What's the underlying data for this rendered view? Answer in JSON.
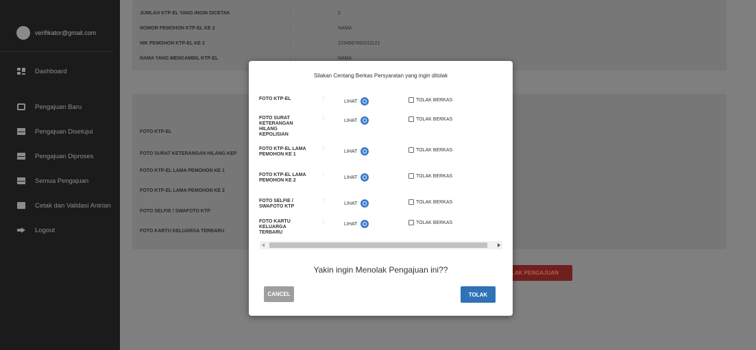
{
  "sidebar": {
    "user_email": "verifikator@gmail.com",
    "items": [
      {
        "label": "Dashboard",
        "icon": "dashboard-icon"
      },
      {
        "label": "Pengajuan Baru",
        "icon": "square-icon"
      },
      {
        "label": "Pengajuan Disetujui",
        "icon": "mail-icon"
      },
      {
        "label": "Pengajuan Diproses",
        "icon": "mail-icon"
      },
      {
        "label": "Semua Pengajuan",
        "icon": "mail-icon"
      },
      {
        "label": "Cetak dan Validasi Antrian",
        "icon": "print-icon"
      },
      {
        "label": "Logout",
        "icon": "logout-icon"
      }
    ]
  },
  "background": {
    "top_rows": [
      {
        "label": "JUMLAH KTP-EL YANG INGIN DICETAK",
        "colon": ":",
        "value": "2"
      },
      {
        "label": "NOMOR PEMOHON KTP-EL KE 2",
        "colon": ":",
        "value": "NAMA"
      },
      {
        "label": "NIK PEMOHON KTP-EL KE 2",
        "colon": ":",
        "value": "1234567891011121"
      },
      {
        "label": "NAMA YANG MENGAMBIL KTP-EL",
        "colon": ":",
        "value": "NAMA"
      }
    ],
    "doc_rows": [
      "FOTO KTP-EL",
      "FOTO SURAT KETERANGAN HILANG KEP",
      "FOTO KTP-EL LAMA PEMOHON KE 1",
      "FOTO KTP-EL LAMA PEMOHON KE 2",
      "FOTO SELFIE / SWAFOTO KTP",
      "FOTO KARTU KELUARGA TERBARU"
    ],
    "reject_button_partial": "LAK PENGAJUAN"
  },
  "modal": {
    "title": "Silakan Centang Berkas Persyaratan yang ingin ditolak",
    "view_label": "LIHAT",
    "reject_label": "TOLAK BERKAS",
    "colon": ":",
    "documents": [
      "FOTO KTP-EL",
      "FOTO SURAT KETERANGAN HILANG KEPOLISIAN",
      "FOTO KTP-EL LAMA PEMOHON KE 1",
      "FOTO KTP-EL LAMA PEMOHON KE 2",
      "FOTO SELFIE / SWAFOTO KTP",
      "FOTO KARTU KELUARGA TERBARU"
    ],
    "confirm_text": "Yakin ingin Menolak Pengajuan ini??",
    "cancel_label": "CANCEL",
    "submit_label": "TOLAK"
  },
  "colors": {
    "sidebar_bg": "#1b1b1b",
    "overlay": "#7f7f7f",
    "primary": "#2f72b6",
    "cancel": "#9e9e9e",
    "eye_icon": "#3a7bc8"
  }
}
